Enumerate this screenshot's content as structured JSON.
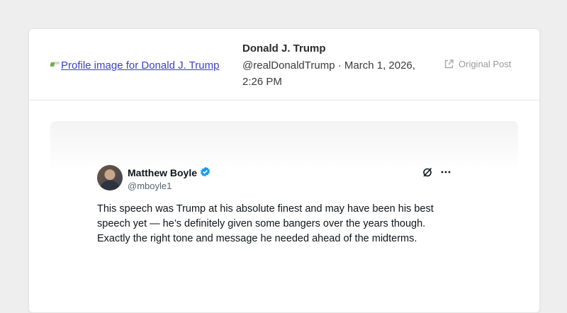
{
  "header": {
    "profile_image_alt": "Profile image for Donald J. Trump",
    "display_name": "Donald J. Trump",
    "meta": "@realDonaldTrump · March 1, 2026, 2:26 PM",
    "original_post_label": "Original Post"
  },
  "embedded_tweet": {
    "author_name": "Matthew Boyle",
    "verified": true,
    "handle": "@mboyle1",
    "text": "This speech was Trump at his absolute finest and may have been his best speech yet — he’s definitely given some bangers over the years though. Exactly the right tone and message he needed ahead of the midterms."
  },
  "colors": {
    "link": "#3c3fc9",
    "verified_badge": "#1d9bf0",
    "muted": "#9a9a9a"
  },
  "icons": [
    "external-link-icon",
    "verified-badge-icon",
    "grok-icon",
    "more-options-icon"
  ]
}
